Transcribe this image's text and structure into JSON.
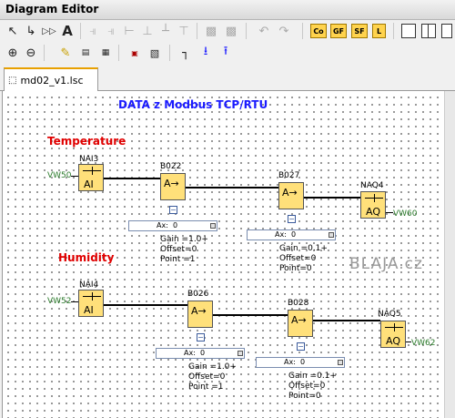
{
  "window": {
    "title": "Diagram Editor"
  },
  "toolbar1": {
    "letter_buttons": [
      "Co",
      "GF",
      "SF",
      "L"
    ],
    "tools": [
      "select-icon",
      "connect-icon",
      "input-output-icon",
      "text-icon"
    ]
  },
  "toolbar2": {
    "tools": [
      "zoom-in-icon",
      "zoom-out-icon",
      "highlight-icon",
      "sim-icon"
    ]
  },
  "tab": {
    "label": "md02_v1.lsc"
  },
  "diagram": {
    "title": "DATA z Modbus TCP/RTU",
    "watermark": "BLAJA.cz",
    "section1": {
      "label": "Temperature",
      "input_var": "VW50",
      "output_var": "VW60",
      "blocks": {
        "nai": {
          "name": "NAI3",
          "symbol": "AI"
        },
        "b1": {
          "name": "B022",
          "symbol": "A→"
        },
        "b2": {
          "name": "B027",
          "symbol": "A→"
        },
        "naq": {
          "name": "NAQ4",
          "symbol": "AQ"
        }
      },
      "param1": {
        "ax": "Ax:",
        "val": "0",
        "gain": "Gain =1.0+",
        "offset": "Offset=0",
        "point": "Point =1"
      },
      "param2": {
        "ax": "Ax:",
        "val": "0",
        "gain": "Gain =0.1+",
        "offset": "Offset=0",
        "point": "Point=0"
      }
    },
    "section2": {
      "label": "Humidity",
      "input_var": "VW52",
      "output_var": "VW62",
      "blocks": {
        "nai": {
          "name": "NAI4",
          "symbol": "AI"
        },
        "b1": {
          "name": "B026",
          "symbol": "A→"
        },
        "b2": {
          "name": "B028",
          "symbol": "A→"
        },
        "naq": {
          "name": "NAQ5",
          "symbol": "AQ"
        }
      },
      "param1": {
        "ax": "Ax:",
        "val": "0",
        "gain": "Gain =1.0+",
        "offset": "Offset=0",
        "point": "Point =1"
      },
      "param2": {
        "ax": "Ax:",
        "val": "0",
        "gain": "Gain =0.1+",
        "offset": "Offset=0",
        "point": "Point=0"
      }
    },
    "colors": {
      "title": "#1a1aff",
      "section_label": "#e00000",
      "var_label": "#2a7a2a",
      "block_fill": "#ffe07a"
    }
  }
}
